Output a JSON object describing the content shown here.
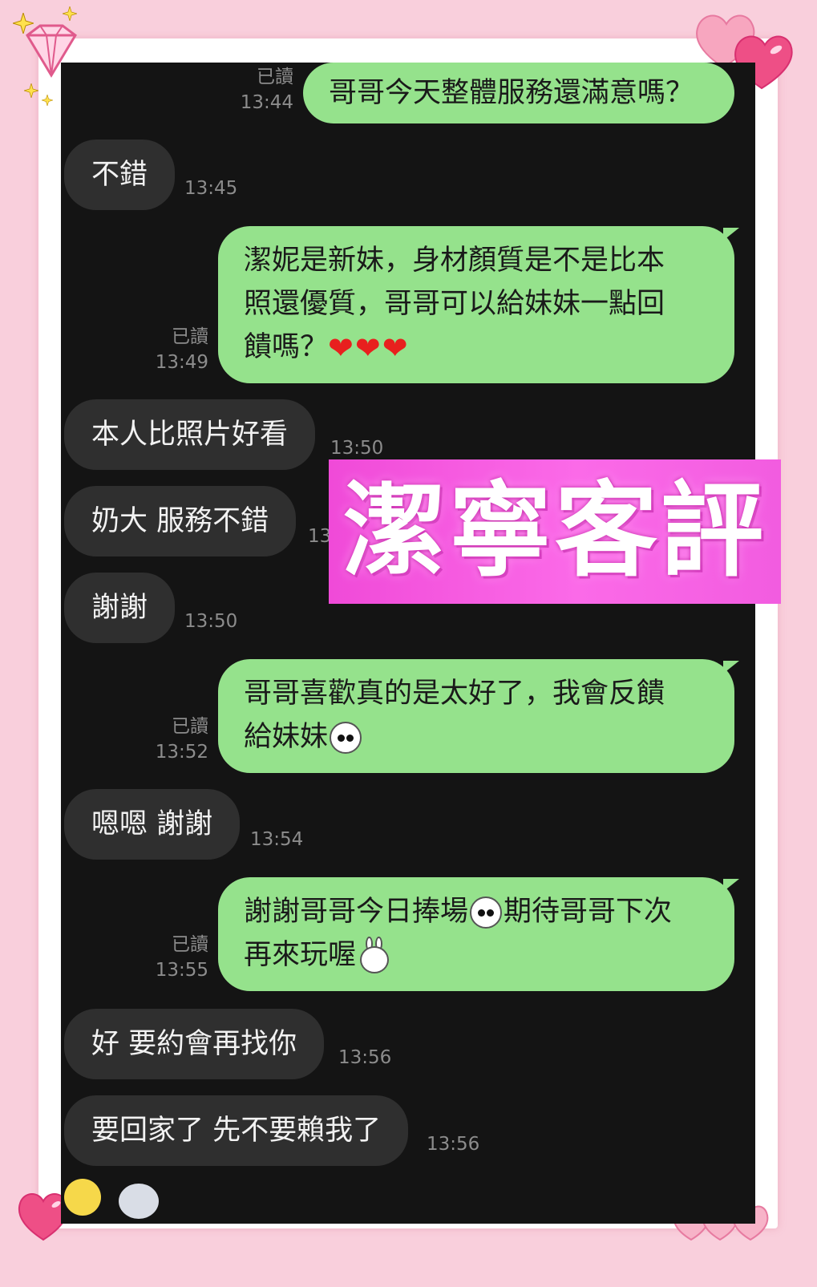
{
  "overlay_title": "潔寧客評",
  "messages": [
    {
      "side": "out",
      "read": "已讀",
      "time": "13:44",
      "text": "哥哥今天整體服務還滿意嗎？"
    },
    {
      "side": "in",
      "time": "13:45",
      "text": "不錯"
    },
    {
      "side": "out",
      "read": "已讀",
      "time": "13:49",
      "line1": "潔妮是新妹，身材顏質是不是比本",
      "line2": "照還優質，哥哥可以給妹妹一點回",
      "line3": "饋嗎？"
    },
    {
      "side": "in",
      "time": "13:50",
      "text": "本人比照片好看"
    },
    {
      "side": "in",
      "time": "13:50",
      "text": "奶大 服務不錯"
    },
    {
      "side": "in",
      "time": "13:50",
      "text": "謝謝"
    },
    {
      "side": "out",
      "read": "已讀",
      "time": "13:52",
      "line1": "哥哥喜歡真的是太好了，我會反饋",
      "line2": "給妹妹"
    },
    {
      "side": "in",
      "time": "13:54",
      "text": "嗯嗯 謝謝"
    },
    {
      "side": "out",
      "read": "已讀",
      "time": "13:55",
      "line1a": "謝謝哥哥今日捧場",
      "line1b": "期待哥哥下次",
      "line2": "再來玩喔"
    },
    {
      "side": "in",
      "time": "13:56",
      "text": "好 要約會再找你"
    },
    {
      "side": "in",
      "time": "13:56",
      "text": "要回家了 先不要賴我了"
    }
  ],
  "icons": {
    "heart": "red-heart-emoji",
    "face": "panda-face-sticker",
    "bunny": "bunny-face-sticker"
  },
  "colors": {
    "outgoing_bubble": "#95e28c",
    "incoming_bubble": "#2f2f2f",
    "chat_background": "#141414",
    "page_background": "#f9cfdc",
    "overlay": "#f04ad8"
  }
}
